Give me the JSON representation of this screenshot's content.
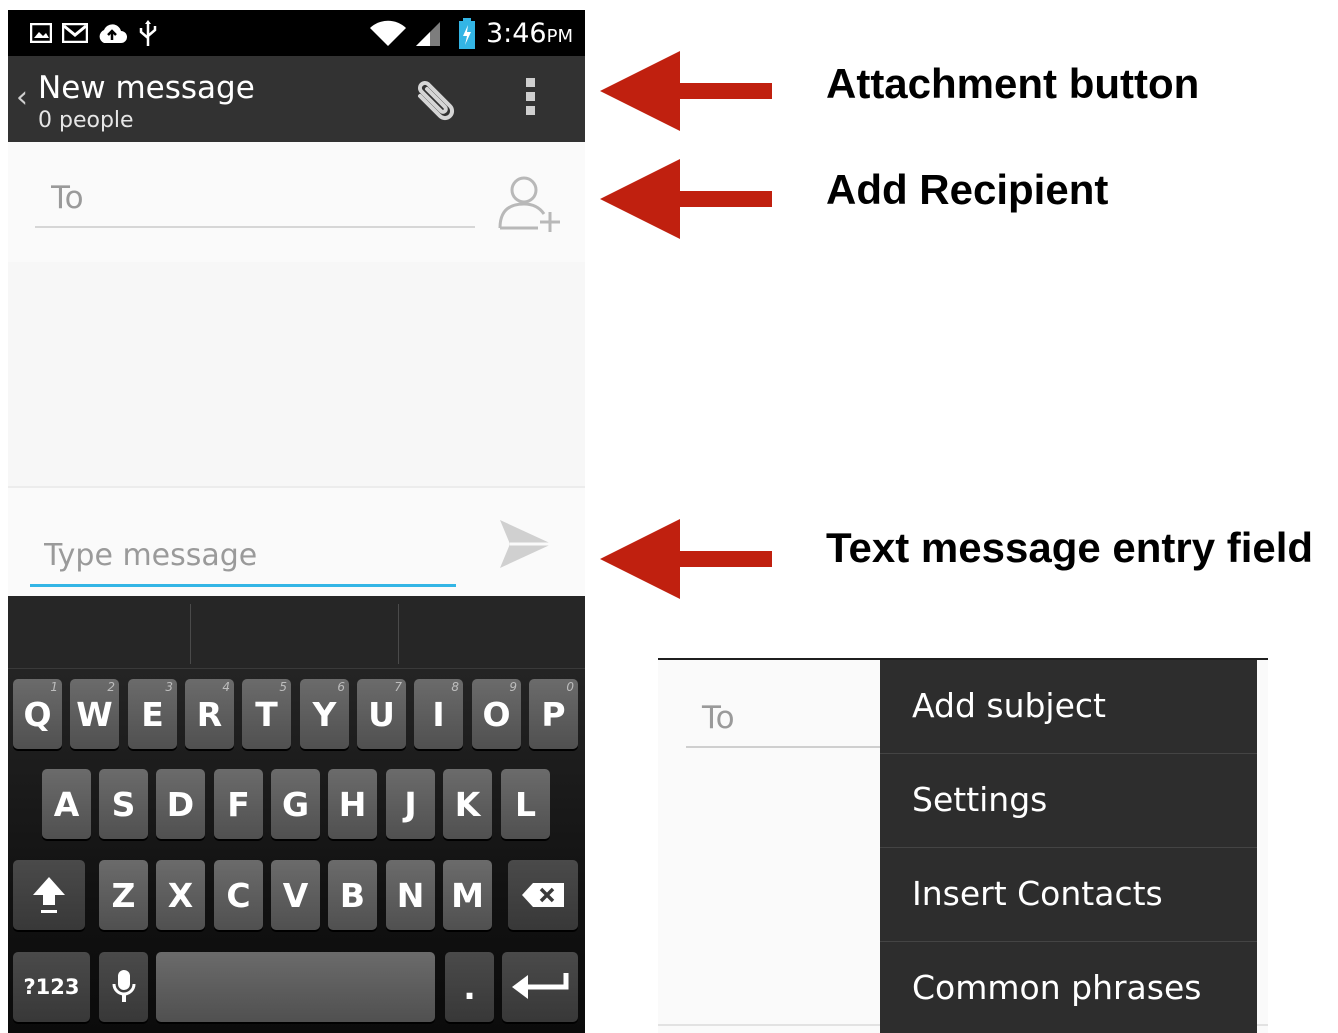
{
  "status_bar": {
    "time": "3:46",
    "time_suffix": "PM",
    "icons": [
      "picture-icon",
      "gmail-icon",
      "cloud-upload-icon",
      "usb-icon",
      "wifi-icon",
      "signal-icon",
      "battery-charging-icon"
    ]
  },
  "action_bar": {
    "title": "New message",
    "subtitle": "0 people",
    "icons": [
      "back-chevron-icon",
      "paperclip-icon",
      "overflow-menu-icon"
    ]
  },
  "recipient": {
    "placeholder": "To",
    "add_icon": "add-person-icon"
  },
  "compose": {
    "placeholder": "Type message",
    "send_icon": "send-icon",
    "accent_color": "#33b5e5"
  },
  "keyboard": {
    "row1": [
      "Q",
      "W",
      "E",
      "R",
      "T",
      "Y",
      "U",
      "I",
      "O",
      "P"
    ],
    "row1_hints": [
      "1",
      "2",
      "3",
      "4",
      "5",
      "6",
      "7",
      "8",
      "9",
      "0"
    ],
    "row2": [
      "A",
      "S",
      "D",
      "F",
      "G",
      "H",
      "J",
      "K",
      "L"
    ],
    "row3": [
      "Z",
      "X",
      "C",
      "V",
      "B",
      "N",
      "M"
    ],
    "symbols_label": "?123",
    "period_label": "."
  },
  "annotations": {
    "attachment": "Attachment button",
    "recipient": "Add Recipient",
    "text_field": "Text message entry field",
    "arrow_color": "#c0200f"
  },
  "menu_inset": {
    "to_placeholder": "To",
    "items": [
      "Add subject",
      "Settings",
      "Insert Contacts",
      "Common phrases"
    ]
  }
}
